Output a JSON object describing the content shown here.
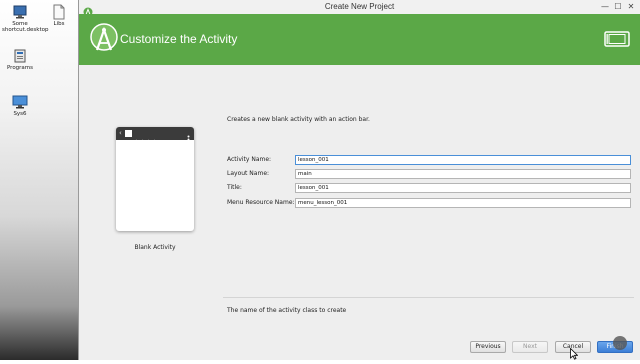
{
  "desktop": {
    "icons": [
      {
        "label": "Some shortcut.desktop",
        "icon": "computer-icon"
      },
      {
        "label": "Libs",
        "icon": "file-icon"
      },
      {
        "label": "Programs",
        "icon": "program-icon"
      },
      {
        "label": "Sys6",
        "icon": "monitor-icon"
      }
    ]
  },
  "window": {
    "title": "Create New Project",
    "controls": {
      "minimize": "—",
      "maximize": "☐",
      "close": "✕"
    }
  },
  "header": {
    "title": "Customize the Activity",
    "accent_color": "#5ba847"
  },
  "template": {
    "description": "Creates a new blank activity with an action bar.",
    "thumbnail_label": "Blank Activity"
  },
  "form": {
    "activity_name_label": "Activity Name:",
    "activity_name_value": "lesson_001",
    "layout_name_label": "Layout Name:",
    "layout_name_value": "main",
    "title_label": "Title:",
    "title_value": "lesson_001",
    "menu_resource_label": "Menu Resource Name:",
    "menu_resource_value": "menu_lesson_001"
  },
  "hint": "The name of the activity class to create",
  "buttons": {
    "previous": "Previous",
    "next": "Next",
    "cancel": "Cancel",
    "finish": "Finish"
  }
}
